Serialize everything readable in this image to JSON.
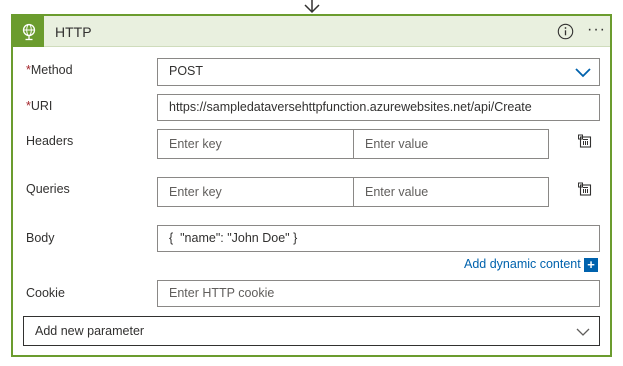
{
  "card": {
    "title": "HTTP",
    "info_icon": "info-icon",
    "more_icon": "more-options-icon",
    "more_label": "···",
    "accent_color": "#6b9c2e",
    "header_bg": "#e9f0df"
  },
  "method": {
    "required_mark": "*",
    "label": "Method",
    "value": "POST"
  },
  "uri": {
    "required_mark": "*",
    "label": "URI",
    "value": "https://sampledataversehttpfunction.azurewebsites.net/api/Create"
  },
  "headers": {
    "label": "Headers",
    "key_placeholder": "Enter key",
    "value_placeholder": "Enter value"
  },
  "queries": {
    "label": "Queries",
    "key_placeholder": "Enter key",
    "value_placeholder": "Enter value"
  },
  "body": {
    "label": "Body",
    "value": "{  \"name\": \"John Doe\" }",
    "dynamic_content_link": "Add dynamic content",
    "dynamic_plus": "+"
  },
  "cookie": {
    "label": "Cookie",
    "placeholder": "Enter HTTP cookie"
  },
  "add_parameter": {
    "label": "Add new parameter"
  },
  "link_color": "#0062ad"
}
